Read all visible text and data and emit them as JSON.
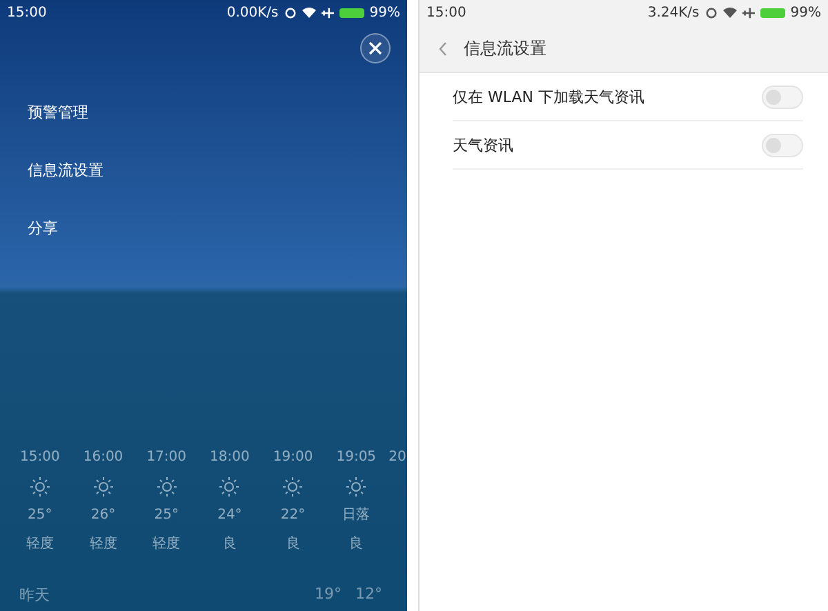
{
  "left_screen": {
    "status_bar": {
      "time": "15:00",
      "speed": "0.00K/s",
      "battery": "99%"
    },
    "menu": [
      {
        "label": "预警管理"
      },
      {
        "label": "信息流设置"
      },
      {
        "label": "分享"
      }
    ],
    "hourly": [
      {
        "time": "15:00",
        "temp": "25°",
        "air": "轻度"
      },
      {
        "time": "16:00",
        "temp": "26°",
        "air": "轻度"
      },
      {
        "time": "17:00",
        "temp": "25°",
        "air": "轻度"
      },
      {
        "time": "18:00",
        "temp": "24°",
        "air": "良"
      },
      {
        "time": "19:00",
        "temp": "22°",
        "air": "良"
      },
      {
        "time": "19:05",
        "temp": "日落",
        "air": "良"
      },
      {
        "time": "20"
      }
    ],
    "yesterday": {
      "label": "昨天",
      "high": "19°",
      "low": "12°"
    }
  },
  "right_screen": {
    "status_bar": {
      "time": "15:00",
      "speed": "3.24K/s",
      "battery": "99%"
    },
    "title": "信息流设置",
    "settings": [
      {
        "label": "仅在 WLAN 下加载天气资讯",
        "checked": false
      },
      {
        "label": "天气资讯",
        "checked": false
      }
    ]
  }
}
